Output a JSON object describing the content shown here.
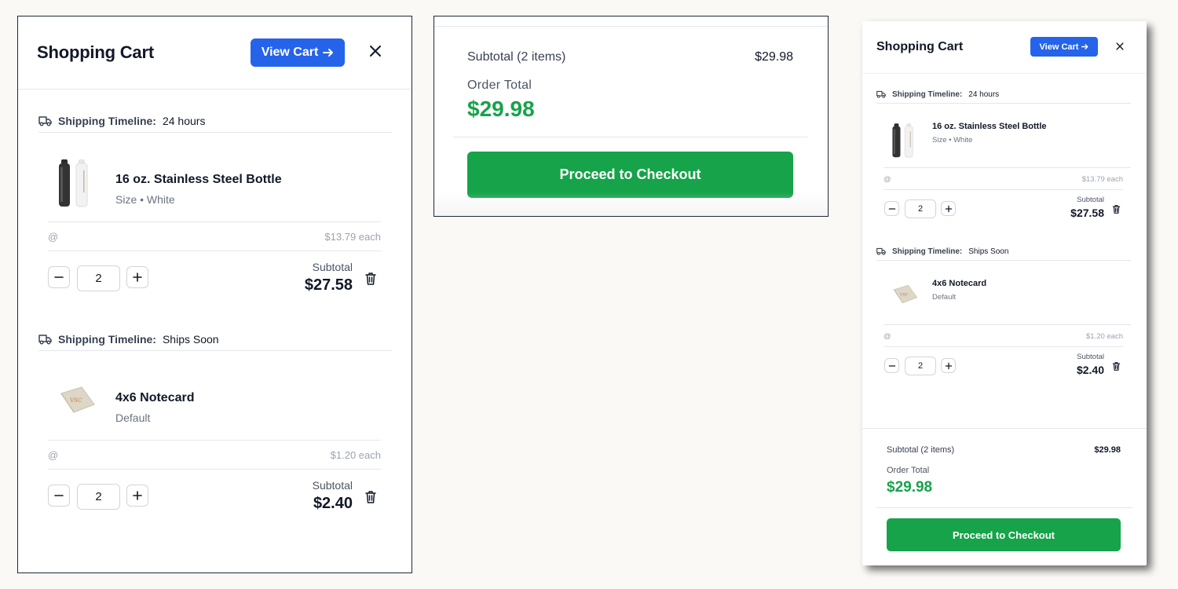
{
  "cart": {
    "title": "Shopping Cart",
    "view_cart_label": "View Cart",
    "close_icon": "close-icon",
    "arrow_icon": "arrow-right-icon"
  },
  "groups": [
    {
      "shipping_label": "Shipping Timeline:",
      "shipping_value": "24 hours",
      "icon": "truck-icon",
      "item": {
        "name": "16 oz. Stainless Steel Bottle",
        "variant": "Size • White",
        "thumbnail": "bottle-thumbnail",
        "at_label": "@",
        "unit_price": "$13.79 each",
        "quantity": "2",
        "subtotal_label": "Subtotal",
        "subtotal": "$27.58"
      }
    },
    {
      "shipping_label": "Shipping Timeline:",
      "shipping_value": "Ships Soon",
      "icon": "truck-icon",
      "item": {
        "name": "4x6 Notecard",
        "variant": "Default",
        "thumbnail": "notecard-thumbnail",
        "at_label": "@",
        "unit_price": "$1.20 each",
        "quantity": "2",
        "subtotal_label": "Subtotal",
        "subtotal": "$2.40"
      }
    }
  ],
  "summary": {
    "subtotal_label": "Subtotal (2 items)",
    "subtotal_value": "$29.98",
    "order_total_label": "Order Total",
    "order_total_value": "$29.98",
    "checkout_label": "Proceed to Checkout"
  },
  "colors": {
    "primary": "#2563eb",
    "success": "#16a34a",
    "page_background": "#fbf9f6"
  }
}
